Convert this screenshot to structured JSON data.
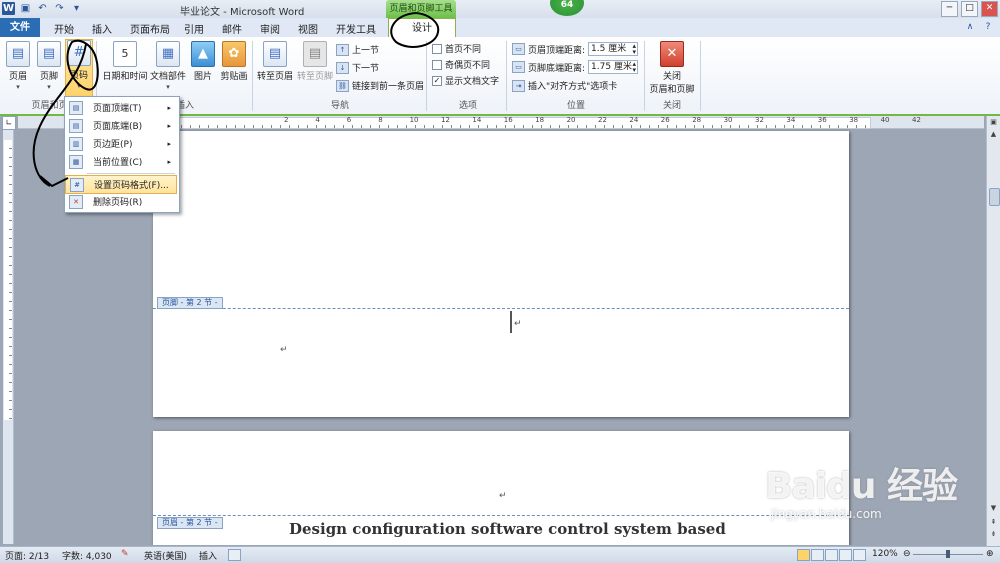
{
  "window": {
    "title": "毕业论文 - Microsoft Word",
    "context_tools_label": "页眉和页脚工具",
    "notification_badge": "64",
    "min_glyph": "─",
    "max_glyph": "□",
    "close_glyph": "✕"
  },
  "tabs": {
    "file": "文件",
    "items": [
      "开始",
      "插入",
      "页面布局",
      "引用",
      "邮件",
      "审阅",
      "视图",
      "开发工具"
    ],
    "active": "设计"
  },
  "ribbon": {
    "header_footer_group": {
      "header": "页眉",
      "footer": "页脚",
      "page_number": "页码",
      "label": "页眉和页脚"
    },
    "insert_group": {
      "date_time": "日期和时间",
      "doc_parts": "文档部件",
      "picture": "图片",
      "clip_art": "剪贴画",
      "label": "插入"
    },
    "nav_group": {
      "goto_header": "转至页眉",
      "goto_footer": "转至页脚",
      "prev_section": "上一节",
      "next_section": "下一节",
      "link_previous": "链接到前一条页眉",
      "label": "导航"
    },
    "options_group": {
      "diff_first": "首页不同",
      "diff_odd_even": "奇偶页不同",
      "show_text": "显示文档文字",
      "show_text_checked": true,
      "label": "选项"
    },
    "position_group": {
      "header_from_top_label": "页眉顶端距离:",
      "header_from_top_value": "1.5 厘米",
      "footer_from_bottom_label": "页脚底端距离:",
      "footer_from_bottom_value": "1.75 厘米",
      "insert_align_tab": "插入\"对齐方式\"选项卡",
      "label": "位置"
    },
    "close_group": {
      "close_btn_line1": "关闭",
      "close_btn_line2": "页眉和页脚",
      "label": "关闭"
    }
  },
  "page_number_menu": {
    "items": [
      {
        "label": "页面顶端(T)",
        "submenu": true
      },
      {
        "label": "页面底端(B)",
        "submenu": true
      },
      {
        "label": "页边距(P)",
        "submenu": true
      },
      {
        "label": "当前位置(C)",
        "submenu": true
      },
      {
        "label": "设置页码格式(F)...",
        "submenu": false,
        "highlighted": true
      },
      {
        "label": "删除页码(R)",
        "submenu": false
      }
    ]
  },
  "ruler": {
    "numbers": [
      "2",
      "4",
      "6",
      "8",
      "10",
      "12",
      "14",
      "16",
      "18",
      "20",
      "22",
      "24",
      "26",
      "28",
      "30",
      "32",
      "34",
      "36",
      "38",
      "40",
      "42"
    ]
  },
  "document": {
    "footer_tag": "页脚 - 第 2 节 -",
    "header_tag": "页眉 - 第 2 节 -",
    "para_mark": "↵",
    "heading_text": "Design configuration software control system based"
  },
  "statusbar": {
    "page": "页面: 2/13",
    "words": "字数: 4,030",
    "language": "英语(美国)",
    "mode": "插入",
    "zoom": "120%",
    "zoom_fraction": 0.5
  },
  "watermark": {
    "main": "Baidu 经验",
    "sub": "jingyan.baidu.com"
  },
  "icons": {
    "word_logo": "word-logo-icon",
    "save": "save-icon",
    "undo": "undo-icon",
    "redo": "redo-icon",
    "help": "help-icon",
    "minimize_ribbon": "minimize-ribbon-icon"
  },
  "colors": {
    "accent_green": "#72b842",
    "file_tab_blue": "#2b6db5",
    "menu_highlight": "#ffe399"
  }
}
